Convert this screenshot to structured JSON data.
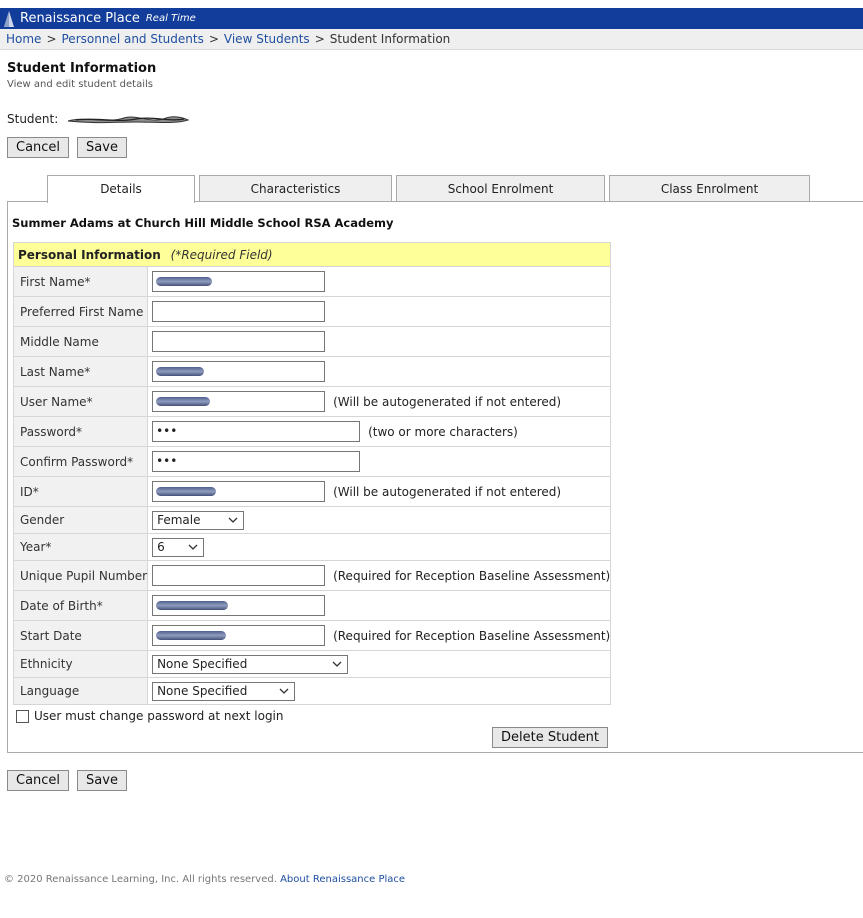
{
  "app": {
    "brand": "Renaissance Place",
    "brand_sub": "Real Time"
  },
  "breadcrumb": [
    "Home",
    "Personnel and Students",
    "View Students",
    "Student Information"
  ],
  "page": {
    "title": "Student Information",
    "subtitle": "View and edit student details",
    "student_label": "Student:"
  },
  "buttons": {
    "cancel": "Cancel",
    "save": "Save",
    "delete_student": "Delete Student"
  },
  "tabs": [
    "Details",
    "Characteristics",
    "School Enrolment",
    "Class Enrolment"
  ],
  "school_line": "Summer Adams at Church Hill Middle School RSA Academy",
  "personal": {
    "header": "Personal Information",
    "required_note": "(*Required Field)",
    "fields": {
      "first_name": "First Name*",
      "preferred_first_name": "Preferred First Name",
      "middle_name": "Middle Name",
      "last_name": "Last Name*",
      "user_name": "User Name*",
      "password": "Password*",
      "confirm_password": "Confirm Password*",
      "id": "ID*",
      "gender": "Gender",
      "year": "Year*",
      "upn": "Unique Pupil Number",
      "dob": "Date of Birth*",
      "start_date": "Start Date",
      "ethnicity": "Ethnicity",
      "language": "Language"
    },
    "notes": {
      "autogen": "(Will be autogenerated if not entered)",
      "two_chars": "(two or more characters)",
      "reception": "(Required for Reception Baseline Assessment)"
    },
    "values": {
      "password": "•••",
      "confirm_password": "•••",
      "gender": "Female",
      "year": "6",
      "ethnicity": "None Specified",
      "language": "None Specified"
    }
  },
  "checkbox_label": "User must change password at next login",
  "footer": {
    "copyright": "© 2020 Renaissance Learning, Inc. All rights reserved.",
    "about_link": "About Renaissance Place"
  }
}
